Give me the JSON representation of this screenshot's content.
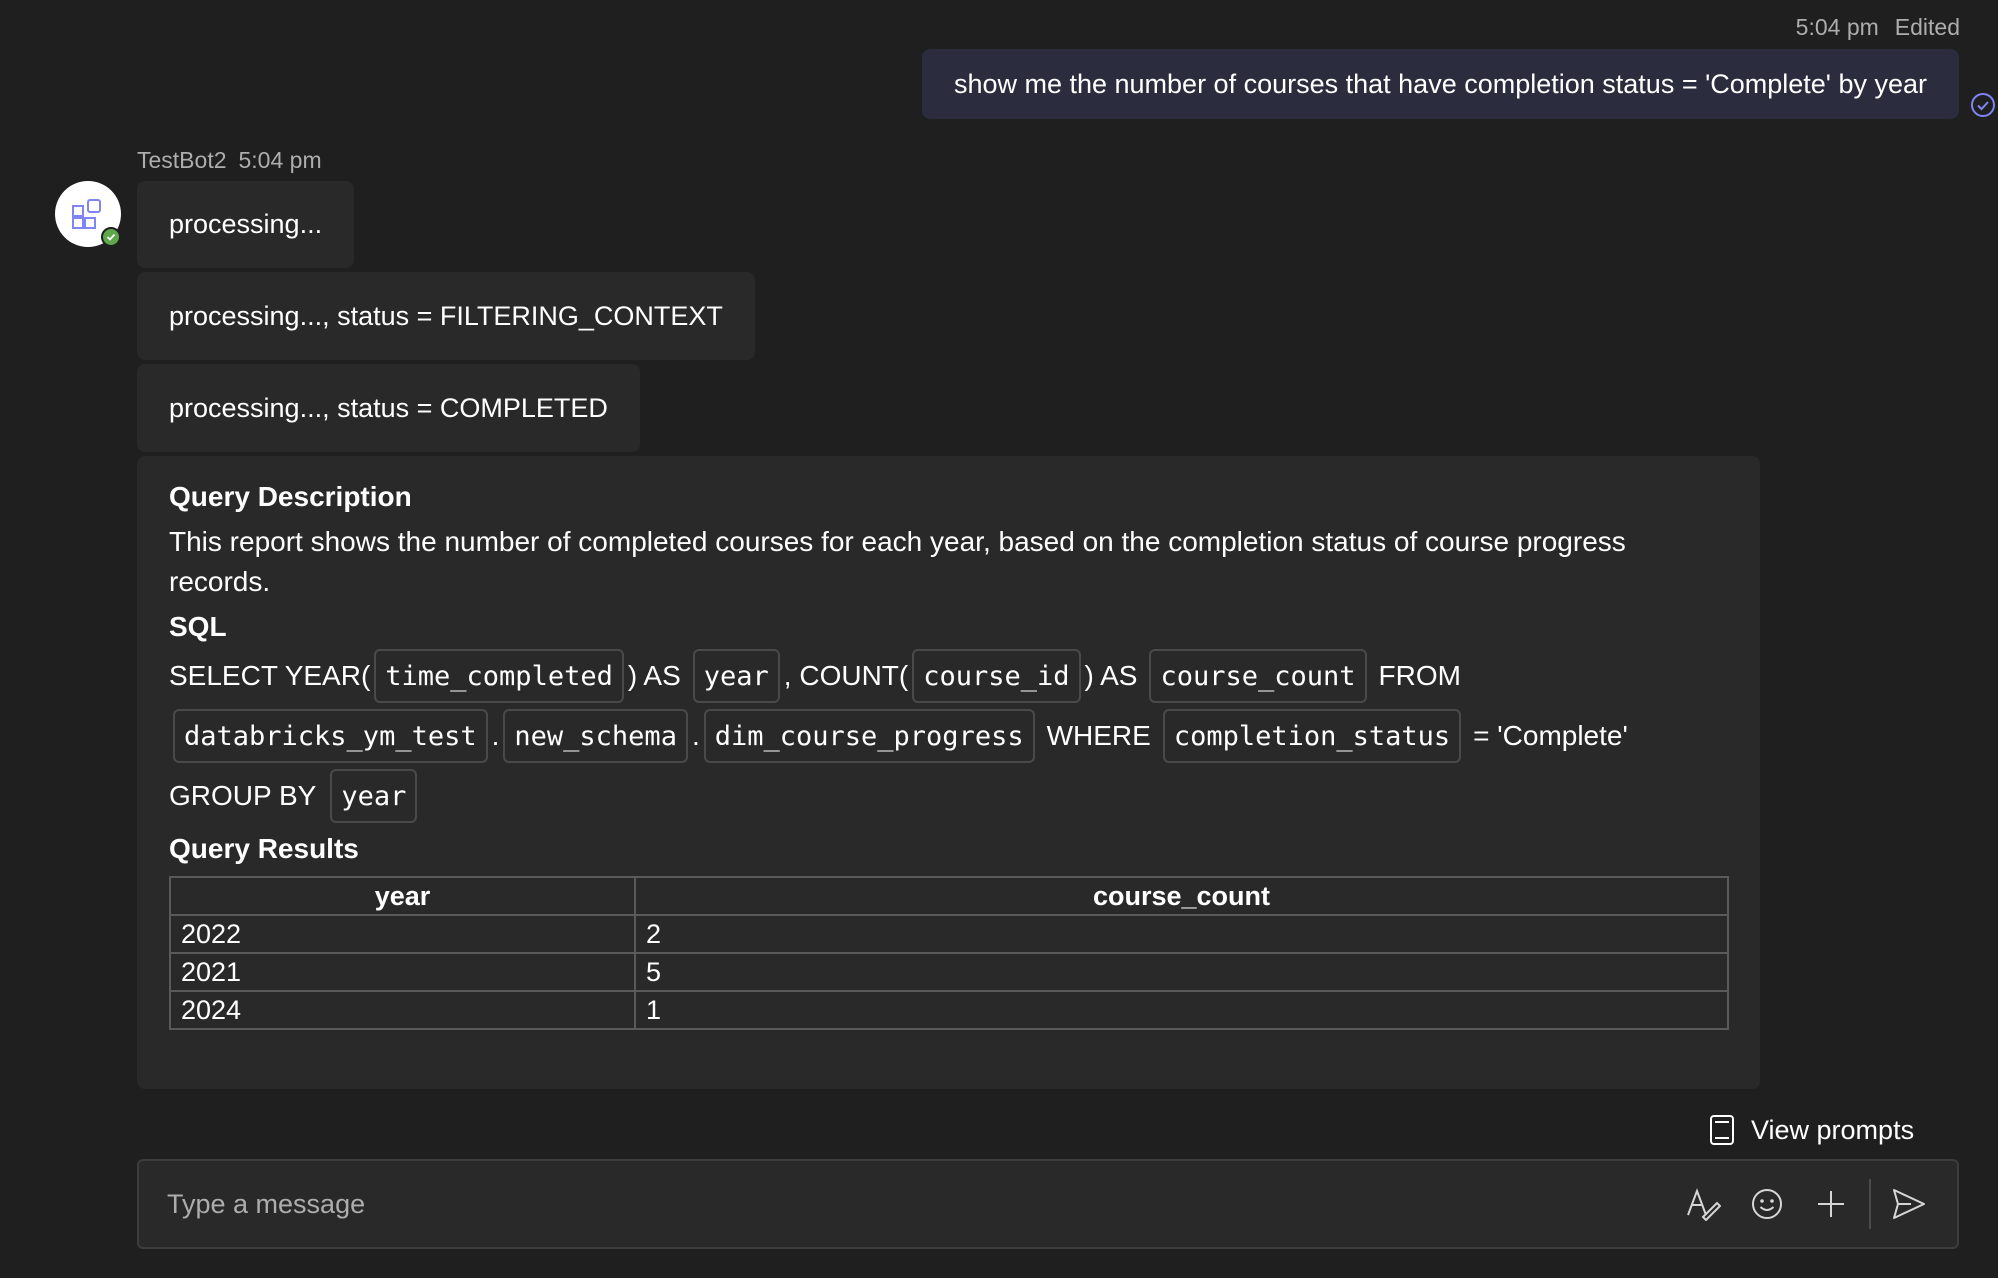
{
  "user_message": {
    "time": "5:04 pm",
    "edited": "Edited",
    "text": "show me the number of courses that have completion status = 'Complete' by year"
  },
  "bot": {
    "name": "TestBot2",
    "time": "5:04 pm",
    "messages": [
      "processing...",
      "processing..., status = FILTERING_CONTEXT",
      "processing..., status = COMPLETED"
    ]
  },
  "card": {
    "description_heading": "Query Description",
    "description": "This report shows the number of completed courses for each year, based on the completion status of course progress records.",
    "sql_heading": "SQL",
    "sql": {
      "t1": "SELECT YEAR(",
      "c1": "time_completed",
      "t2": ") AS",
      "c2": "year",
      "t3": ", COUNT(",
      "c3": "course_id",
      "t4": ") AS",
      "c4": "course_count",
      "t5": "FROM",
      "c5": "databricks_ym_test",
      "dot1": ".",
      "c6": "new_schema",
      "dot2": ".",
      "c7": "dim_course_progress",
      "t6": "WHERE",
      "c8": "completion_status",
      "t7": "= 'Complete'",
      "t8": "GROUP BY",
      "c9": "year"
    },
    "results_heading": "Query Results",
    "table": {
      "headers": [
        "year",
        "course_count"
      ],
      "rows": [
        [
          "2022",
          "2"
        ],
        [
          "2021",
          "5"
        ],
        [
          "2024",
          "1"
        ]
      ]
    }
  },
  "view_prompts": "View prompts",
  "composer": {
    "placeholder": "Type a message"
  },
  "icons": {
    "read": "read-receipt-icon",
    "avatar": "bot-apps-icon",
    "prompts": "prompts-book-icon",
    "format": "format-icon",
    "emoji": "emoji-icon",
    "add": "plus-icon",
    "send": "send-icon"
  },
  "colors": {
    "background": "#1f1f1f",
    "bubble": "#292929",
    "user_bubble": "#2b2d3e",
    "accent": "#7f85f5",
    "status_green": "#5ca84a"
  }
}
